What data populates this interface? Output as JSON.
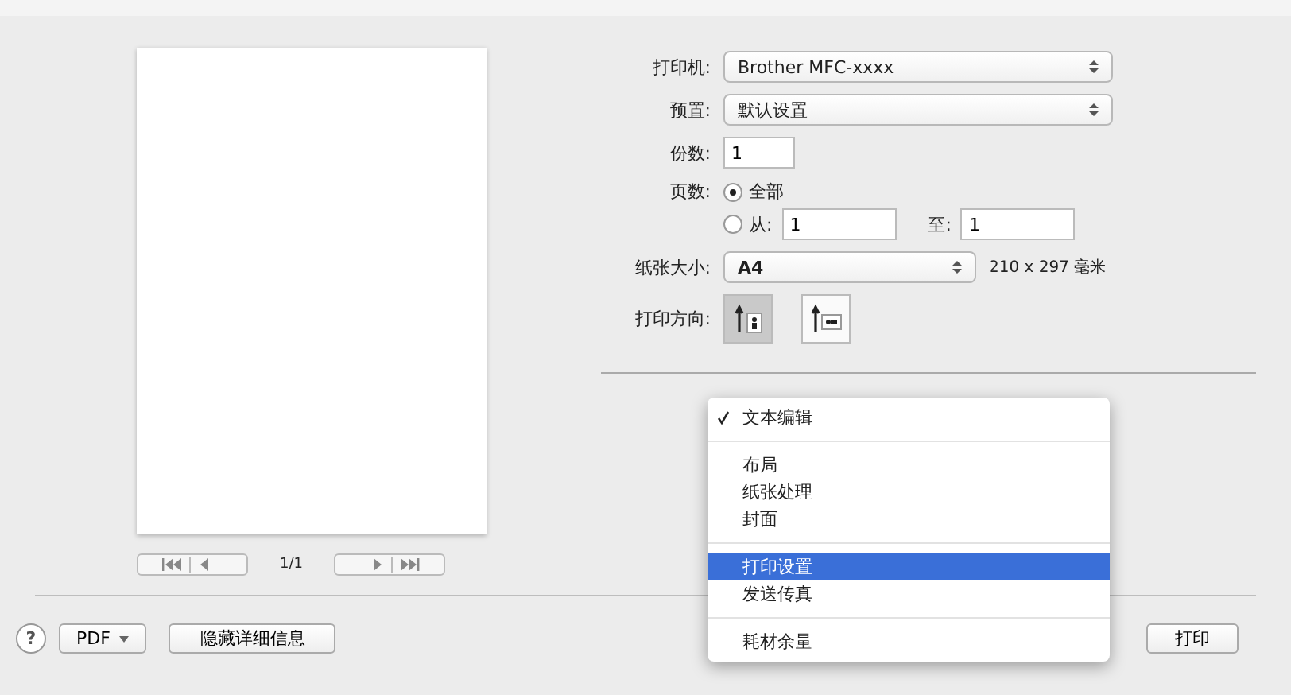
{
  "preview": {
    "page_indicator": "1/1"
  },
  "printer": {
    "label": "打印机:",
    "value": "Brother MFC-xxxx"
  },
  "preset": {
    "label": "预置:",
    "value": "默认设置"
  },
  "copies": {
    "label": "份数:",
    "value": "1"
  },
  "pages": {
    "label": "页数:",
    "options": [
      {
        "label": "全部",
        "selected": true
      },
      {
        "label": "从:",
        "selected": false
      }
    ],
    "from": "1",
    "to_label": "至:",
    "to": "1"
  },
  "paper_size": {
    "label": "纸张大小:",
    "value": "A4",
    "dimensions": "210 x 297 毫米"
  },
  "orientation": {
    "label": "打印方向:",
    "options": [
      {
        "kind": "portrait",
        "selected": true
      },
      {
        "kind": "landscape",
        "selected": false
      }
    ]
  },
  "menu": {
    "sections": [
      {
        "items": [
          {
            "label": "文本编辑",
            "checked": true,
            "selected": false
          }
        ]
      },
      {
        "items": [
          {
            "label": "布局",
            "checked": false,
            "selected": false
          },
          {
            "label": "纸张处理",
            "checked": false,
            "selected": false
          },
          {
            "label": "封面",
            "checked": false,
            "selected": false
          }
        ]
      },
      {
        "items": [
          {
            "label": "打印设置",
            "checked": false,
            "selected": true
          },
          {
            "label": "发送传真",
            "checked": false,
            "selected": false
          }
        ]
      },
      {
        "items": [
          {
            "label": "耗材余量",
            "checked": false,
            "selected": false
          }
        ]
      }
    ]
  },
  "footer": {
    "help": "?",
    "pdf": "PDF",
    "hide_details": "隐藏详细信息",
    "print": "打印"
  }
}
